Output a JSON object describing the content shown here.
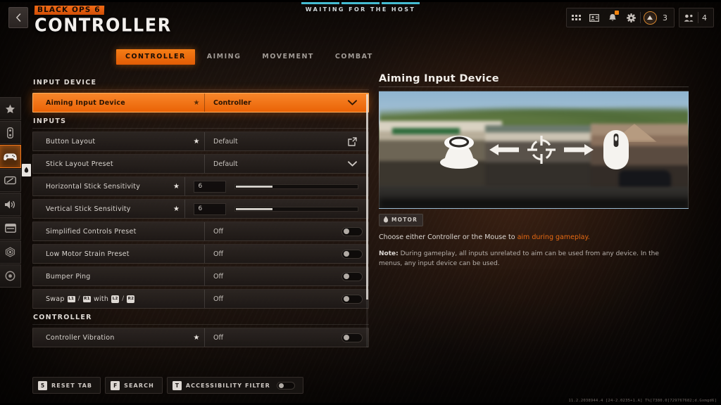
{
  "header": {
    "back_icon": "chevron-left-icon",
    "franchise_logo": "BLACK OPS 6",
    "title": "CONTROLLER",
    "lobby_status": "WAITING FOR THE HOST",
    "lobby_bar_count": 3,
    "icons": [
      {
        "name": "apps-grid-icon",
        "glyph": "grid"
      },
      {
        "name": "id-card-icon",
        "glyph": "card"
      },
      {
        "name": "notifications-bell-icon",
        "glyph": "bell",
        "badge": true
      },
      {
        "name": "settings-gear-icon",
        "glyph": "gear"
      }
    ],
    "currency": {
      "icon": "cod-points-icon",
      "value": "3"
    },
    "party": {
      "icon": "party-members-icon",
      "value": "4"
    }
  },
  "tabs": [
    {
      "label": "CONTROLLER",
      "active": true
    },
    {
      "label": "AIMING",
      "active": false
    },
    {
      "label": "MOVEMENT",
      "active": false
    },
    {
      "label": "COMBAT",
      "active": false
    }
  ],
  "rail": [
    {
      "name": "sidebar-item-favorites",
      "icon": "star-icon",
      "active": false
    },
    {
      "name": "sidebar-item-account",
      "icon": "battery-icon",
      "active": false
    },
    {
      "name": "sidebar-item-controller",
      "icon": "gamepad-icon",
      "active": true
    },
    {
      "name": "sidebar-item-mouse-keyboard",
      "icon": "keyboard-mouse-icon",
      "active": false
    },
    {
      "name": "sidebar-item-audio",
      "icon": "speaker-icon",
      "active": false
    },
    {
      "name": "sidebar-item-interface",
      "icon": "display-icon",
      "active": false
    },
    {
      "name": "sidebar-item-graphics",
      "icon": "graphics-icon",
      "active": false
    },
    {
      "name": "sidebar-item-accessibility",
      "icon": "accessibility-icon",
      "active": false
    }
  ],
  "sections": [
    {
      "heading": "INPUT DEVICE",
      "rows": [
        {
          "label": "Aiming Input Device",
          "star": true,
          "value": "Controller",
          "control": "dropdown",
          "highlight": true
        }
      ]
    },
    {
      "heading": "INPUTS",
      "rows": [
        {
          "label": "Button Layout",
          "star": true,
          "value": "Default",
          "control": "open-external",
          "highlight": false
        },
        {
          "label": "Stick Layout Preset",
          "star": false,
          "value": "Default",
          "control": "dropdown",
          "highlight": false
        },
        {
          "label": "Horizontal Stick Sensitivity",
          "star": true,
          "value": "6",
          "control": "slider",
          "slider_percent": 30,
          "highlight": false
        },
        {
          "label": "Vertical Stick Sensitivity",
          "star": true,
          "value": "6",
          "control": "slider",
          "slider_percent": 30,
          "highlight": false
        },
        {
          "label": "Simplified Controls Preset",
          "star": false,
          "value": "Off",
          "control": "toggle",
          "toggle_on": false,
          "highlight": false
        },
        {
          "label": "Low Motor Strain Preset",
          "star": false,
          "value": "Off",
          "control": "toggle",
          "toggle_on": false,
          "highlight": false
        },
        {
          "label": "Bumper Ping",
          "star": false,
          "value": "Off",
          "control": "toggle",
          "toggle_on": false,
          "highlight": false
        },
        {
          "label": "Swap",
          "label_parts": [
            "Swap",
            "L1",
            "/",
            "R1",
            "with",
            "L2",
            "/",
            "R2"
          ],
          "star": false,
          "value": "Off",
          "control": "toggle",
          "toggle_on": false,
          "highlight": false
        }
      ]
    },
    {
      "heading": "CONTROLLER",
      "rows": [
        {
          "label": "Controller Vibration",
          "star": true,
          "value": "Off",
          "control": "toggle",
          "toggle_on": false,
          "highlight": false
        }
      ]
    }
  ],
  "detail": {
    "title": "Aiming Input Device",
    "preview_alt": "Thumbstick and mouse with crosshair between them over a blurred street scene",
    "preview_icons": [
      "thumbstick-icon",
      "arrow-left-icon",
      "crosshair-icon",
      "arrow-right-icon",
      "mouse-icon"
    ],
    "motor_tag": {
      "icon": "motor-icon",
      "label": "MOTOR"
    },
    "description_before": "Choose either Controller or the Mouse to ",
    "description_accent": "aim during gameplay.",
    "note_prefix": "Note:",
    "note_body": " During gameplay, all inputs unrelated to aim can be used from any device. In the menus, any input device can be used."
  },
  "bottom_bar": [
    {
      "key": "5",
      "label": "RESET TAB",
      "name": "reset-tab-button",
      "toggle": false
    },
    {
      "key": "F",
      "label": "SEARCH",
      "name": "search-button",
      "toggle": false
    },
    {
      "key": "T",
      "label": "ACCESSIBILITY FILTER",
      "name": "accessibility-filter-button",
      "toggle": true,
      "toggle_on": false
    }
  ],
  "debug_text": "11.2.2038944.4 [24-2.0235+1.A] T%[7380.0]729767682;d.Gxmgd6]",
  "colors": {
    "accent": "#f07116",
    "highlight_row": "#f0760c",
    "lobby": "#49c6dd",
    "panel": "#231e1b"
  }
}
